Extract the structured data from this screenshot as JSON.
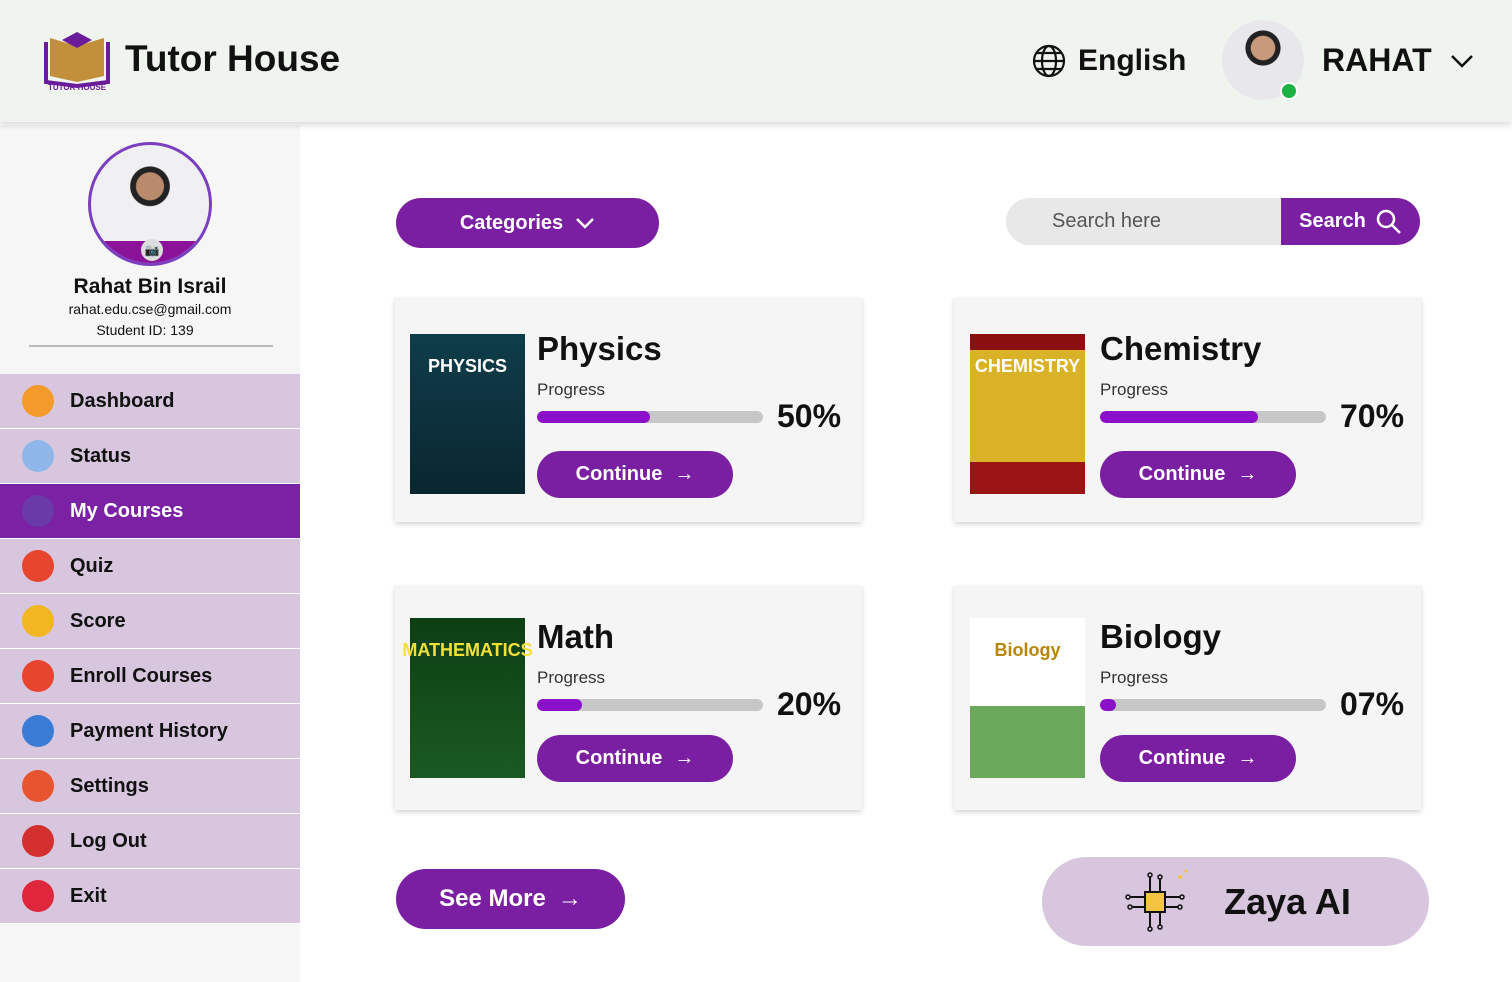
{
  "header": {
    "brand": "Tutor House",
    "logo_text": "TUTOR HOUSE",
    "language": "English",
    "username": "RAHAT"
  },
  "profile": {
    "name": "Rahat Bin Israil",
    "email": "rahat.edu.cse@gmail.com",
    "student_id": "Student ID: 139"
  },
  "sidebar": {
    "items": [
      {
        "label": "Dashboard",
        "icon": "home-icon",
        "color": "#f39a2b"
      },
      {
        "label": "Status",
        "icon": "chart-icon",
        "color": "#8fb6e8"
      },
      {
        "label": "My Courses",
        "icon": "courses-icon",
        "color": "#6a3aa8"
      },
      {
        "label": "Quiz",
        "icon": "quiz-icon",
        "color": "#e8452f"
      },
      {
        "label": "Score",
        "icon": "medal-icon",
        "color": "#f2b623"
      },
      {
        "label": "Enroll Courses",
        "icon": "enroll-icon",
        "color": "#e8452f"
      },
      {
        "label": "Payment History",
        "icon": "payment-icon",
        "color": "#3a7bd5"
      },
      {
        "label": "Settings",
        "icon": "gear-icon",
        "color": "#e8542f"
      },
      {
        "label": "Log Out",
        "icon": "logout-icon",
        "color": "#d32f2f"
      },
      {
        "label": "Exit",
        "icon": "exit-icon",
        "color": "#e0263a"
      }
    ],
    "active": "My Courses"
  },
  "toolbar": {
    "categories": "Categories",
    "search_placeholder": "Search here",
    "search_button": "Search"
  },
  "courses": [
    {
      "title": "Physics",
      "cover": "PHYSICS",
      "progress_label": "Progress",
      "progress": 50,
      "percent_text": "50%",
      "button": "Continue"
    },
    {
      "title": "Chemistry",
      "cover": "CHEMISTRY",
      "progress_label": "Progress",
      "progress": 70,
      "percent_text": "70%",
      "button": "Continue"
    },
    {
      "title": "Math",
      "cover": "MATHEMATICS",
      "progress_label": "Progress",
      "progress": 20,
      "percent_text": "20%",
      "button": "Continue"
    },
    {
      "title": "Biology",
      "cover": "Biology",
      "progress_label": "Progress",
      "progress": 7,
      "percent_text": "07%",
      "button": "Continue"
    }
  ],
  "see_more": "See More",
  "zaya": "Zaya AI",
  "colors": {
    "accent": "#7b1fa2",
    "sidebar": "#d7c6de",
    "header": "#eff5ee"
  }
}
